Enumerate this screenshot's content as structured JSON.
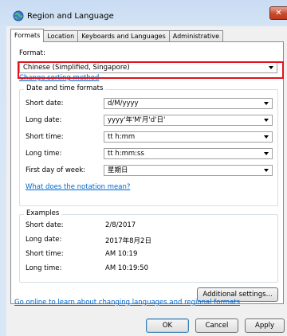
{
  "window": {
    "title": "Region and Language",
    "close_label": "✕"
  },
  "tabs": [
    {
      "label": "Formats"
    },
    {
      "label": "Location"
    },
    {
      "label": "Keyboards and Languages"
    },
    {
      "label": "Administrative"
    }
  ],
  "format": {
    "label": "Format:",
    "value": "Chinese (Simplified, Singapore)",
    "sort_link": "Change sorting method"
  },
  "datetime": {
    "group_title": "Date and time formats",
    "rows": [
      {
        "label": "Short date:",
        "value": "d/M/yyyy"
      },
      {
        "label": "Long date:",
        "value": "yyyy'年'M'月'd'日'"
      },
      {
        "label": "Short time:",
        "value": "tt h:mm"
      },
      {
        "label": "Long time:",
        "value": "tt h:mm:ss"
      },
      {
        "label": "First day of week:",
        "value": "星期日"
      }
    ],
    "notation_link": "What does the notation mean?"
  },
  "examples": {
    "group_title": "Examples",
    "rows": [
      {
        "label": "Short date:",
        "value": "2/8/2017"
      },
      {
        "label": "Long date:",
        "value": "2017年8月2日"
      },
      {
        "label": "Short time:",
        "value": "AM 10:19"
      },
      {
        "label": "Long time:",
        "value": "AM 10:19:50"
      }
    ]
  },
  "buttons": {
    "additional": "Additional settings...",
    "ok": "OK",
    "cancel": "Cancel",
    "apply": "Apply"
  },
  "online_link": "Go online to learn about changing languages and regional formats",
  "colors": {
    "highlight": "#e0141e",
    "link": "#0066cc"
  }
}
